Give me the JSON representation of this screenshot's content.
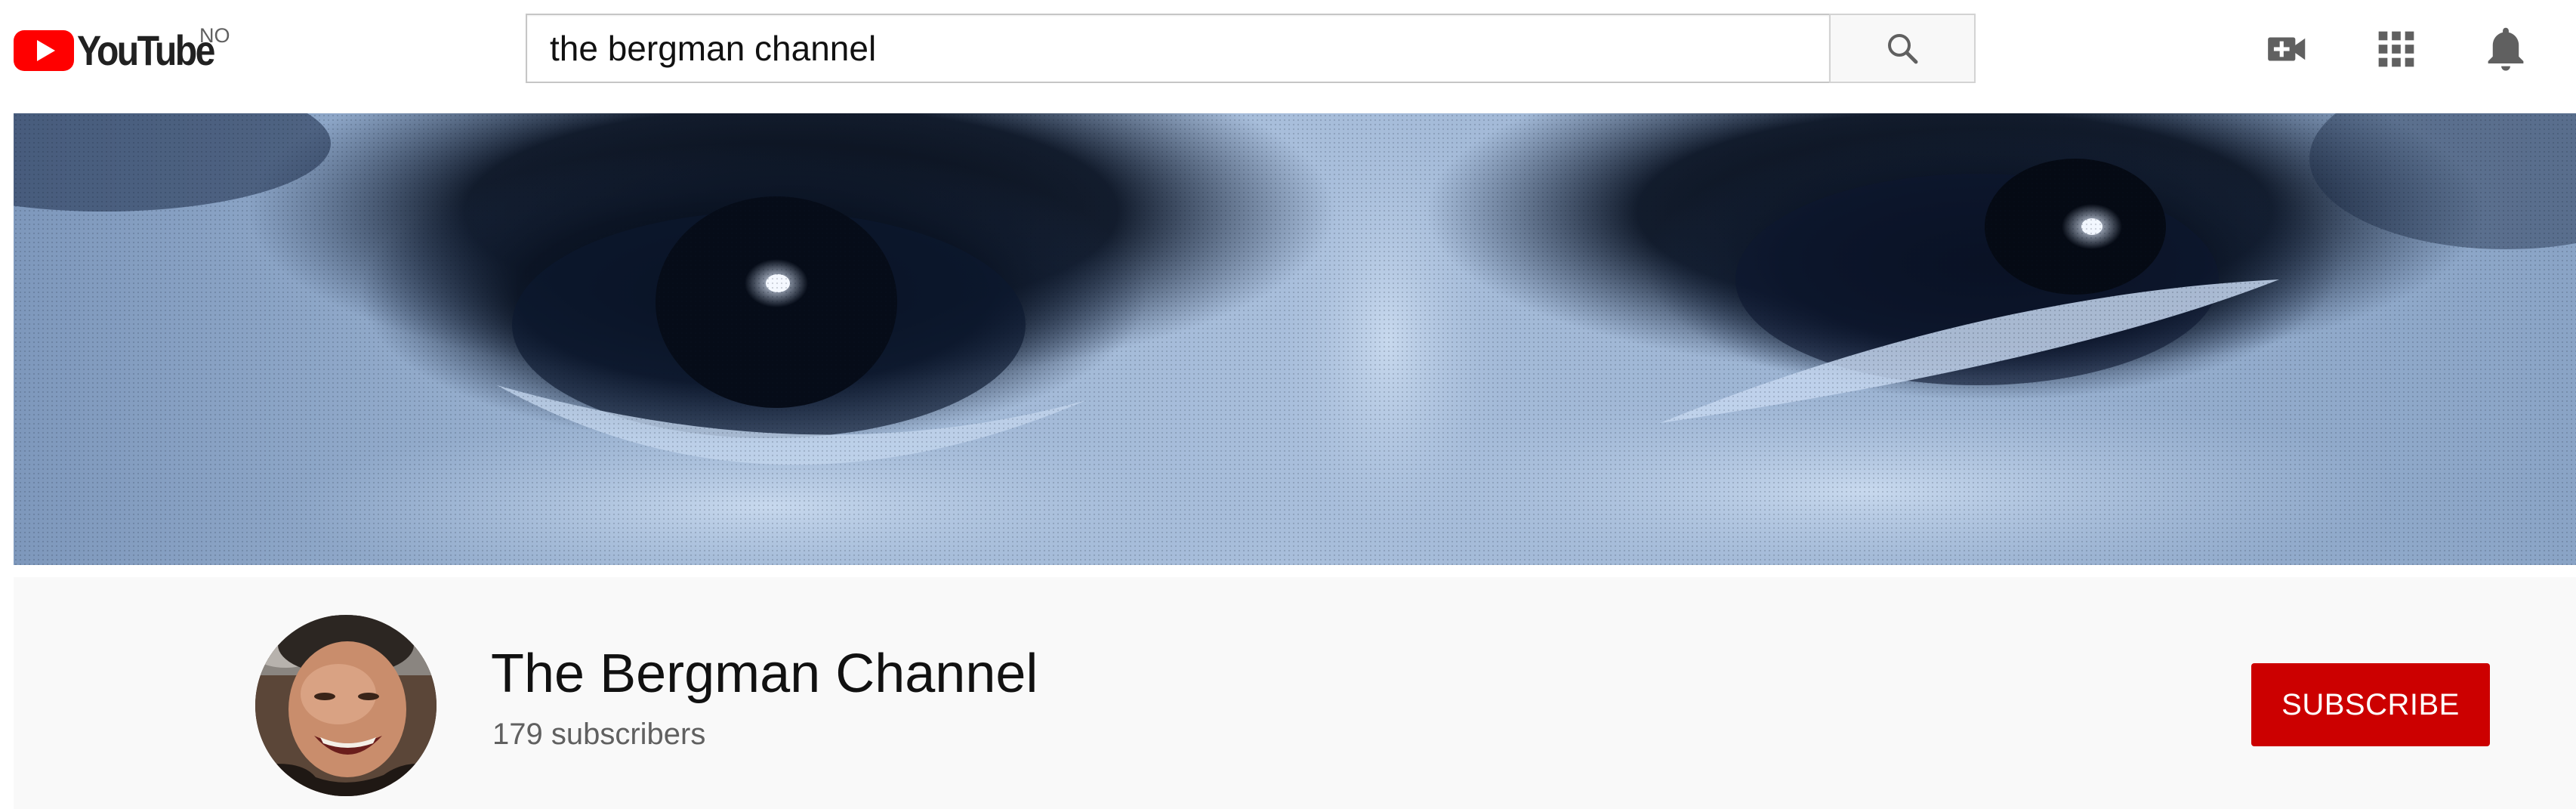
{
  "masthead": {
    "logo_text": "YouTube",
    "country_code": "NO",
    "search": {
      "value": "the bergman channel",
      "button_icon": "search-icon"
    },
    "icons": [
      "create-video-icon",
      "apps-grid-icon",
      "notifications-bell-icon"
    ]
  },
  "banner": {
    "description_icon": "channel-banner"
  },
  "channel": {
    "name": "The Bergman Channel",
    "subscribers": "179 subscribers",
    "subscribe_label": "SUBSCRIBE"
  },
  "colors": {
    "brand_red": "#ff0000",
    "subscribe_red": "#cc0000",
    "header_bg": "#f9f9f9",
    "icon_gray": "#606060"
  }
}
